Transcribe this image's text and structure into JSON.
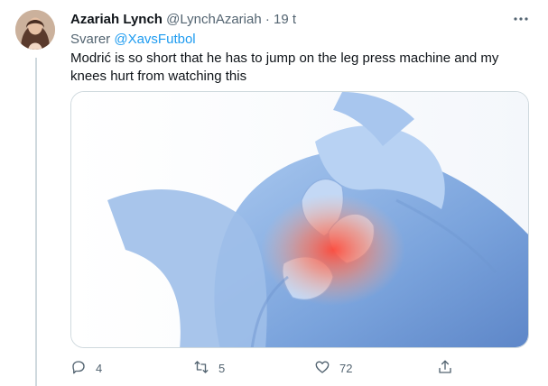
{
  "tweet": {
    "display_name": "Azariah Lynch",
    "handle": "@LynchAzariah",
    "separator": "·",
    "time": "19 t",
    "replying_prefix": "Svarer",
    "replying_to": "@XavsFutbol",
    "text": "Modrić is so short that he has to jump on the leg press machine and my knees hurt from watching this"
  },
  "media": {
    "description_icon": "knee-pain-illustration"
  },
  "actions": {
    "reply_count": "4",
    "retweet_count": "5",
    "like_count": "72"
  },
  "icons": [
    "more-icon",
    "reply-icon",
    "retweet-icon",
    "like-icon",
    "share-icon"
  ],
  "colors": {
    "link": "#1d9bf0",
    "secondary_text": "#536471",
    "border": "#cfd9de"
  }
}
